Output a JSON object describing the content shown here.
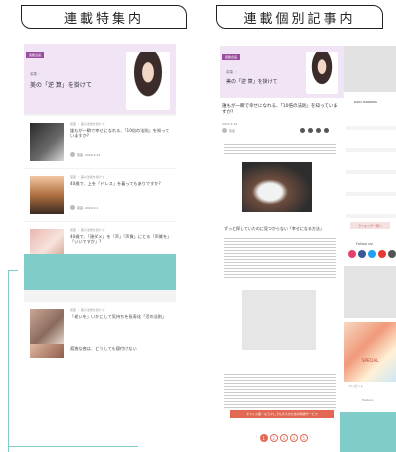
{
  "tabs": {
    "left": "連載特集内",
    "right": "連載個別記事内"
  },
  "left_phone": {
    "hero": {
      "badge": "連載企画",
      "category": "茉菓 ・",
      "title": "美の「逆 算」を掛けて"
    },
    "cards": [
      {
        "meta": "茉菓 ・ 美の法則を掛けて",
        "title": "誰もが一瞬で幸せになれる、「10倍の法則」を知っていますか?",
        "author": "茉菓",
        "date": "2022.4.19"
      },
      {
        "meta": "茉菓 ・ 美の法則を掛けて",
        "title": "40歳で、上を「ドレス」を着ってもありですか?",
        "author": "茉菓",
        "date": "2022.4.1"
      },
      {
        "meta": "茉菓 ・ 美の法則を掛けて",
        "title": "40歳で、「顔ダメ」を「声」「声質」にとる「声質を」「いいですか」?",
        "author": "茉菓",
        "date": "2022.3.19"
      },
      {
        "meta": "茉菓 ・ 美の法則を掛けて",
        "title": "「老いを」いかにして気持ちを長寿化「活の法則」",
        "author": "茉菓",
        "date": "2022.2.19"
      },
      {
        "meta": "茉菓 ・ 美の法則を掛けて",
        "title": "孤独な夜は、どうしても寝付けない",
        "author": "茉菓",
        "date": "2022.1.19"
      }
    ]
  },
  "right_phone": {
    "hero": {
      "badge": "連載企画",
      "category": "茉菓 ・",
      "title": "美の「逆 算」を掛けて"
    },
    "article_title": "誰もが一瞬で幸せになれる、「10倍の法則」を知っていますか?",
    "date": "2022.4.19",
    "author": "茉菓",
    "section_heading": "ずっと探していたのに見つからない「幸せになる方法」",
    "cta": "オフィス美・もう少しでも大人のための情報サービス",
    "pagination": [
      "1",
      "2",
      "3",
      "4",
      "5"
    ],
    "sidebar": {
      "ranking": "DAILY RANKING",
      "ranking_more": "ランキング一覧へ",
      "follow": "Follow us!",
      "feature": "Feature",
      "present": "プレゼント",
      "special": "SPECIAL"
    }
  },
  "colors": {
    "teal": "#80ccc8",
    "purple": "#9b4d9e",
    "hero_bg": "#f0e4f5"
  }
}
